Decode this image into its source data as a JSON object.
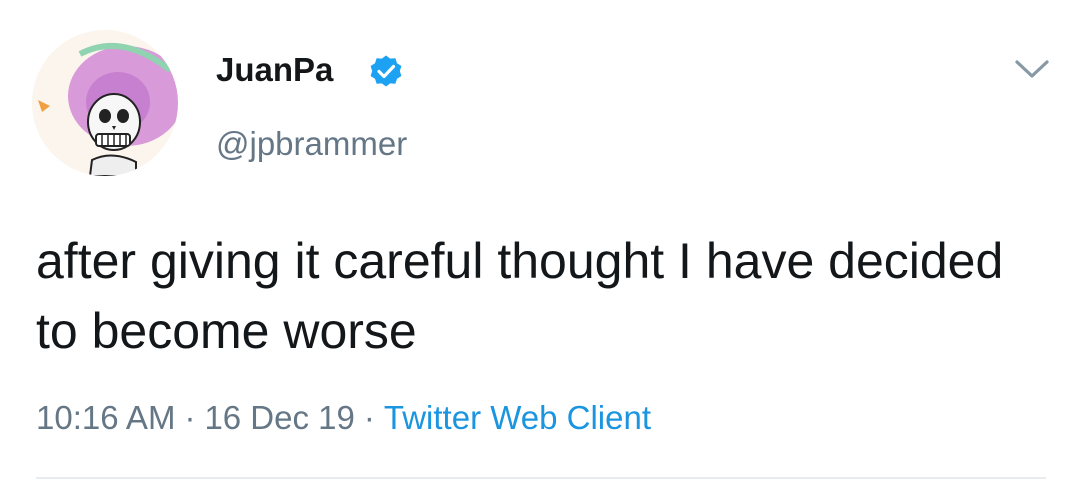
{
  "tweet": {
    "display_name": "JuanPa",
    "username": "@jpbrammer",
    "text": "after giving it careful thought I have decided to become worse",
    "time": "10:16 AM",
    "separator_1": "·",
    "date": "16 Dec 19",
    "separator_2": "·",
    "client": "Twitter Web Client"
  },
  "icons": {
    "verified": "verified-badge-icon",
    "menu": "chevron-down-icon"
  },
  "colors": {
    "text_primary": "#14171a",
    "text_secondary": "#657786",
    "link": "#1b95e0",
    "verified_blue": "#1da1f2",
    "divider": "#e6ecf0"
  }
}
